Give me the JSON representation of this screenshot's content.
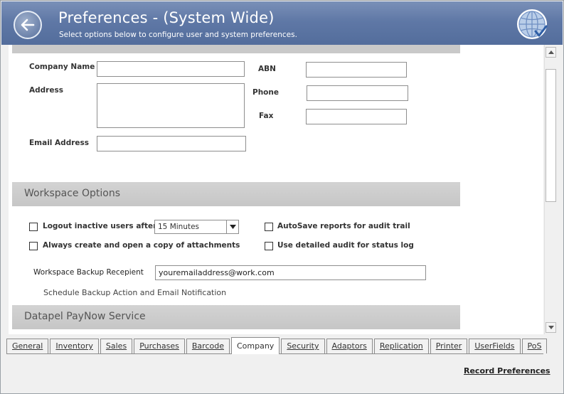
{
  "header": {
    "title": "Preferences - (System Wide)",
    "subtitle": "Select options below to configure user and system preferences."
  },
  "company": {
    "company_name_label": "Company Name",
    "address_label": "Address",
    "email_label": "Email Address",
    "abn_label": "ABN",
    "phone_label": "Phone",
    "fax_label": "Fax"
  },
  "workspace": {
    "section_title": "Workspace Options",
    "logout_label": "Logout inactive users after",
    "logout_value": "15 Minutes",
    "autosave_label": "AutoSave reports for audit trail",
    "copy_attach_label": "Always create and open a copy of attachments",
    "detailed_audit_label": "Use detailed audit for status log",
    "backup_label": "Workspace Backup Recepient",
    "backup_value": "youremailaddress@work.com",
    "schedule_link": "Schedule Backup Action and Email Notification"
  },
  "paynow": {
    "section_title": "Datapel PayNow Service"
  },
  "tabs": [
    {
      "label": "General"
    },
    {
      "label": "Inventory"
    },
    {
      "label": "Sales"
    },
    {
      "label": "Purchases"
    },
    {
      "label": "Barcode"
    },
    {
      "label": "Company"
    },
    {
      "label": "Security"
    },
    {
      "label": "Adaptors"
    },
    {
      "label": "Replication"
    },
    {
      "label": "Printer"
    },
    {
      "label": "UserFields"
    },
    {
      "label": "PoS"
    }
  ],
  "footer": {
    "record_label": "Record Preferences"
  },
  "colors": {
    "header": "#5f78a6",
    "section_band": "#c9c9c9"
  }
}
